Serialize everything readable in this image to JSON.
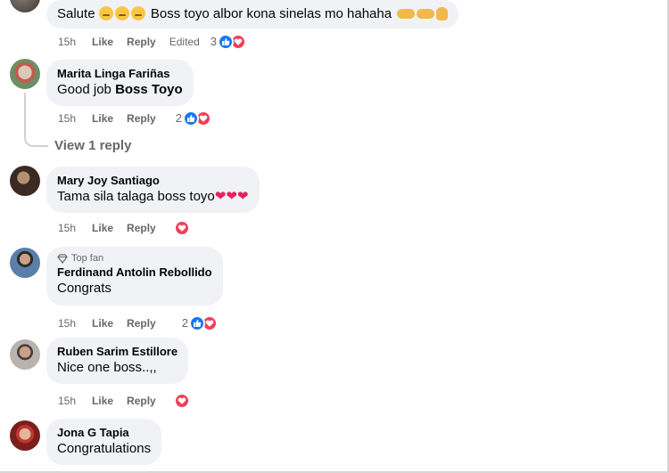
{
  "comments": [
    {
      "author": "",
      "text_plain": "Salute",
      "text_after": "Boss toyo albor kona sinelas mo hahaha",
      "time": "15h",
      "like": "Like",
      "reply": "Reply",
      "edited": "Edited",
      "reactions": "3"
    },
    {
      "author": "Marita Linga Fariñas",
      "text_plain": "Good job",
      "text_bold": "Boss Toyo",
      "time": "15h",
      "like": "Like",
      "reply": "Reply",
      "reactions": "2",
      "view_replies": "View 1 reply"
    },
    {
      "author": "Mary Joy Santiago",
      "text_plain": "Tama sila talaga boss toyo",
      "time": "15h",
      "like": "Like",
      "reply": "Reply"
    },
    {
      "badge": "Top fan",
      "author": "Ferdinand Antolin Rebollido",
      "text_plain": "Congrats",
      "time": "15h",
      "like": "Like",
      "reply": "Reply",
      "reactions": "2"
    },
    {
      "author": "Ruben Sarim Estillore",
      "text_plain": "Nice one boss..,,",
      "time": "15h",
      "like": "Like",
      "reply": "Reply"
    },
    {
      "author": "Jona G Tapia",
      "text_plain": "Congratulations"
    }
  ],
  "colors": {
    "like_blue": "#1877f2",
    "love_red": "#f33e58",
    "bubble": "#f0f2f5",
    "meta": "#65676b"
  }
}
